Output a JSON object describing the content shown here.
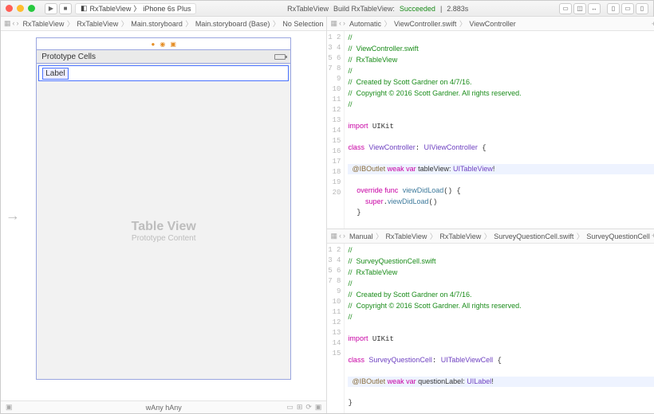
{
  "titlebar": {
    "scheme": "RxTableView",
    "device": "iPhone 6s Plus",
    "status_app": "RxTableView",
    "status_action": "Build RxTableView:",
    "status_result": "Succeeded",
    "status_time": "2.883s"
  },
  "left": {
    "crumbs": [
      "RxTableView",
      "RxTableView",
      "Main.storyboard",
      "Main.storyboard (Base)",
      "No Selection"
    ],
    "proto_header": "Prototype Cells",
    "cell_label": "Label",
    "tv_title": "Table View",
    "tv_sub": "Prototype Content",
    "size_class": "wAny hAny"
  },
  "right_top": {
    "crumbs": [
      "Automatic",
      "ViewController.swift",
      "ViewController"
    ],
    "lines": [
      {
        "n": 1,
        "html": "<span class='c-comment'>//</span>"
      },
      {
        "n": 2,
        "html": "<span class='c-comment'>//  ViewController.swift</span>"
      },
      {
        "n": 3,
        "html": "<span class='c-comment'>//  RxTableView</span>"
      },
      {
        "n": 4,
        "html": "<span class='c-comment'>//</span>"
      },
      {
        "n": 5,
        "html": "<span class='c-comment'>//  Created by Scott Gardner on 4/7/16.</span>"
      },
      {
        "n": 6,
        "html": "<span class='c-comment'>//  Copyright © 2016 Scott Gardner. All rights reserved.</span>"
      },
      {
        "n": 7,
        "html": "<span class='c-comment'>//</span>"
      },
      {
        "n": 8,
        "html": ""
      },
      {
        "n": 9,
        "html": "<span class='c-keyword'>import</span> UIKit"
      },
      {
        "n": 10,
        "html": ""
      },
      {
        "n": 11,
        "html": "<span class='c-keyword'>class</span> <span class='c-type'>ViewController</span>: <span class='c-type'>UIViewController</span> {"
      },
      {
        "n": 12,
        "html": ""
      },
      {
        "n": 13,
        "html": "  <span class='c-attr'>@IBOutlet</span> <span class='c-keyword'>weak var</span> tableView: <span class='c-type'>UITableView</span>!",
        "hl": true
      },
      {
        "n": 14,
        "html": ""
      },
      {
        "n": 15,
        "html": "  <span class='c-keyword'>override func</span> <span class='c-func'>viewDidLoad</span>() {"
      },
      {
        "n": 16,
        "html": "    <span class='c-keyword'>super</span>.<span class='c-func'>viewDidLoad</span>()"
      },
      {
        "n": 17,
        "html": "  }"
      },
      {
        "n": 18,
        "html": ""
      },
      {
        "n": 19,
        "html": "}"
      },
      {
        "n": 20,
        "html": ""
      }
    ]
  },
  "right_bot": {
    "crumbs": [
      "Manual",
      "RxTableView",
      "RxTableView",
      "SurveyQuestionCell.swift",
      "SurveyQuestionCell"
    ],
    "lines": [
      {
        "n": 1,
        "html": "<span class='c-comment'>//</span>"
      },
      {
        "n": 2,
        "html": "<span class='c-comment'>//  SurveyQuestionCell.swift</span>"
      },
      {
        "n": 3,
        "html": "<span class='c-comment'>//  RxTableView</span>"
      },
      {
        "n": 4,
        "html": "<span class='c-comment'>//</span>"
      },
      {
        "n": 5,
        "html": "<span class='c-comment'>//  Created by Scott Gardner on 4/7/16.</span>"
      },
      {
        "n": 6,
        "html": "<span class='c-comment'>//  Copyright © 2016 Scott Gardner. All rights reserved.</span>"
      },
      {
        "n": 7,
        "html": "<span class='c-comment'>//</span>"
      },
      {
        "n": 8,
        "html": ""
      },
      {
        "n": 9,
        "html": "<span class='c-keyword'>import</span> UIKit"
      },
      {
        "n": 10,
        "html": ""
      },
      {
        "n": 11,
        "html": "<span class='c-keyword'>class</span> <span class='c-type'>SurveyQuestionCell</span>: <span class='c-type'>UITableViewCell</span> {"
      },
      {
        "n": 12,
        "html": ""
      },
      {
        "n": 13,
        "html": "  <span class='c-attr'>@IBOutlet</span> <span class='c-keyword'>weak var</span> questionLabel: <span class='c-type'>UILabel</span>!",
        "hl": true
      },
      {
        "n": 14,
        "html": ""
      },
      {
        "n": 15,
        "html": "}"
      }
    ]
  }
}
